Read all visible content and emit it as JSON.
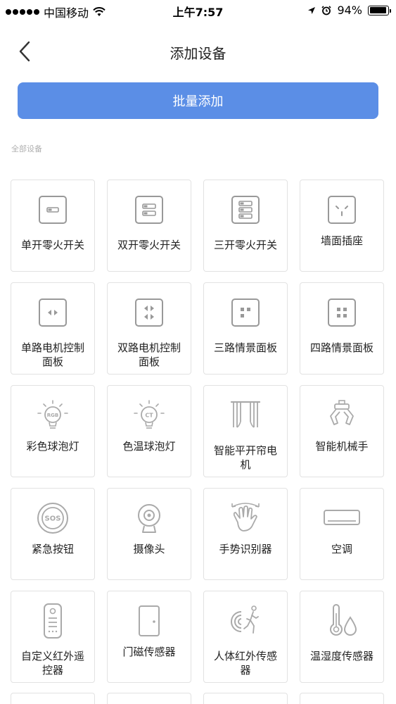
{
  "status_bar": {
    "carrier": "中国移动",
    "time": "上午7:57",
    "battery_percent": "94%",
    "battery_level": 0.94
  },
  "nav": {
    "title": "添加设备",
    "back_icon": "chevron-left-icon"
  },
  "batch_button": {
    "label": "批量添加",
    "color": "#5b8ee6"
  },
  "section": {
    "label": "全部设备"
  },
  "devices": [
    {
      "label": "单开零火开关",
      "icon": "single-switch-icon"
    },
    {
      "label": "双开零火开关",
      "icon": "double-switch-icon"
    },
    {
      "label": "三开零火开关",
      "icon": "triple-switch-icon"
    },
    {
      "label": "墙面插座",
      "icon": "wall-socket-icon"
    },
    {
      "label": "单路电机控制面板",
      "icon": "single-motor-panel-icon"
    },
    {
      "label": "双路电机控制面板",
      "icon": "double-motor-panel-icon"
    },
    {
      "label": "三路情景面板",
      "icon": "three-scene-panel-icon"
    },
    {
      "label": "四路情景面板",
      "icon": "four-scene-panel-icon"
    },
    {
      "label": "彩色球泡灯",
      "icon": "rgb-bulb-icon"
    },
    {
      "label": "色温球泡灯",
      "icon": "ct-bulb-icon"
    },
    {
      "label": "智能平开帘电机",
      "icon": "curtain-motor-icon"
    },
    {
      "label": "智能机械手",
      "icon": "robot-claw-icon"
    },
    {
      "label": "紧急按钮",
      "icon": "sos-button-icon"
    },
    {
      "label": "摄像头",
      "icon": "camera-icon"
    },
    {
      "label": "手势识别器",
      "icon": "gesture-sensor-icon"
    },
    {
      "label": "空调",
      "icon": "air-conditioner-icon"
    },
    {
      "label": "自定义红外遥控器",
      "icon": "ir-remote-icon"
    },
    {
      "label": "门磁传感器",
      "icon": "door-sensor-icon"
    },
    {
      "label": "人体红外传感器",
      "icon": "motion-sensor-icon"
    },
    {
      "label": "温湿度传感器",
      "icon": "temp-humidity-sensor-icon"
    }
  ]
}
